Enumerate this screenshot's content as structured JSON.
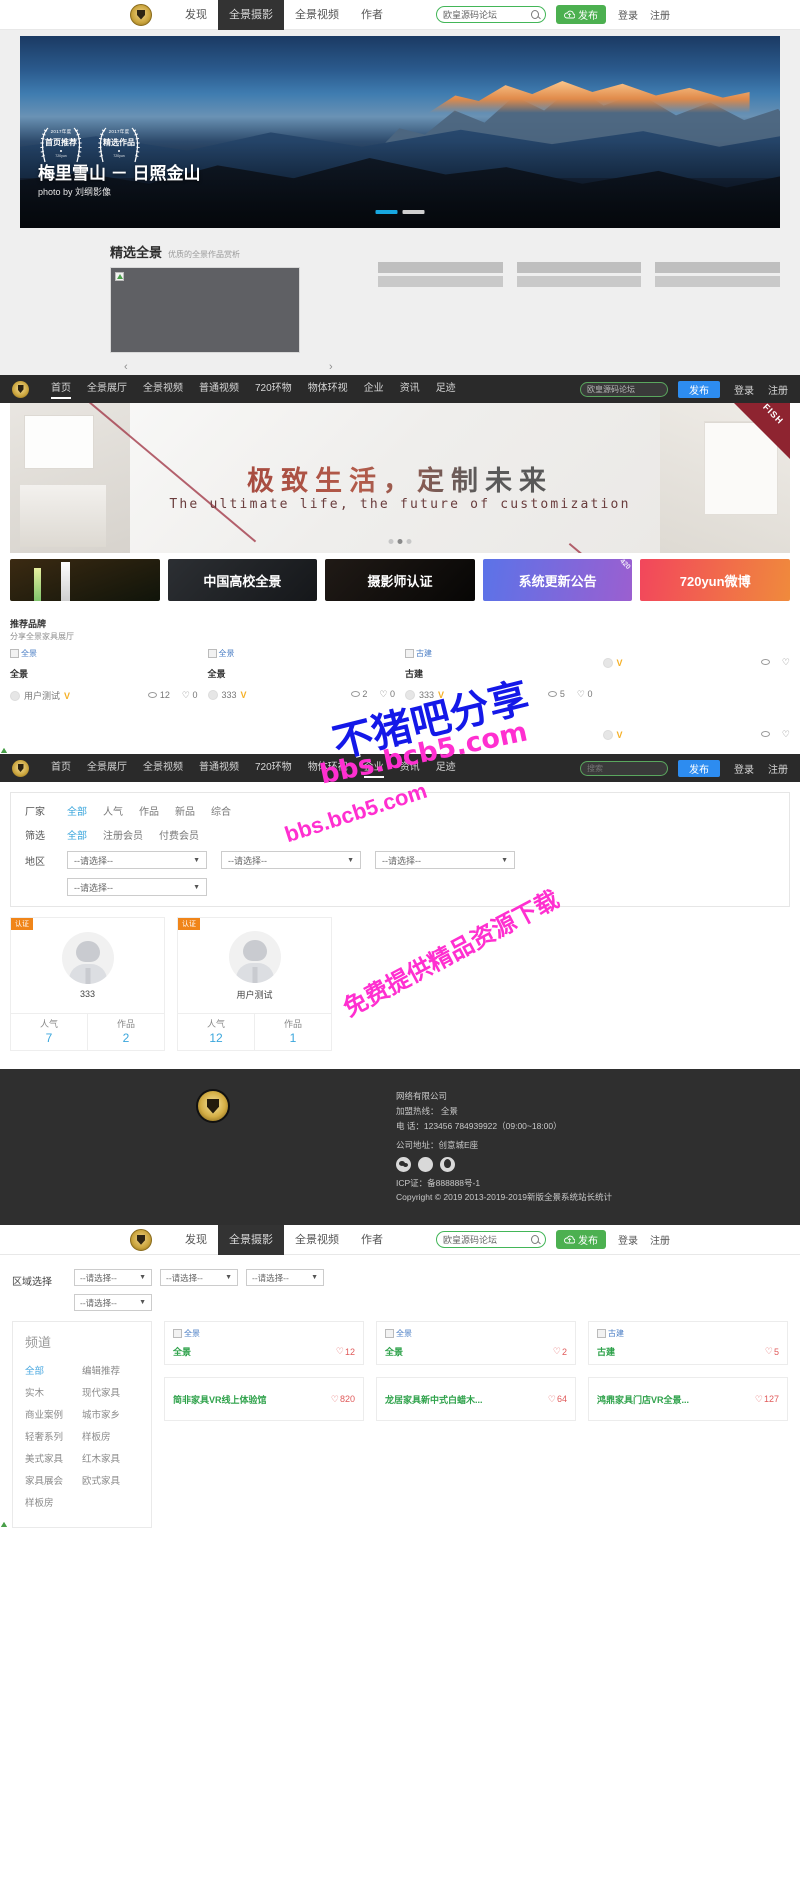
{
  "topnav": {
    "logo_icon": "shield-logo-icon",
    "items": [
      {
        "label": "发现",
        "active": false
      },
      {
        "label": "全景摄影",
        "active": true
      },
      {
        "label": "全景视频",
        "active": false
      },
      {
        "label": "作者",
        "active": false
      }
    ],
    "search": {
      "value": "欧皇源码论坛",
      "placeholder": "搜索",
      "icon": "search-icon"
    },
    "publish": {
      "label": "发布",
      "icon": "cloud-upload-icon"
    },
    "login": "登录",
    "register": "注册"
  },
  "hero": {
    "title": "梅里雪山 － 日照金山",
    "photo_by": "photo by 刘纲影像",
    "badges": [
      {
        "year": "2017年度",
        "title": "首页推荐",
        "sub": "720yun"
      },
      {
        "year": "2017年度",
        "title": "精选作品",
        "sub": "720yun"
      }
    ],
    "dots": [
      true,
      false
    ]
  },
  "featured": {
    "title": "精选全景",
    "desc": "优质的全景作品赏析",
    "prev_icon": "chevron-left-icon",
    "next_icon": "chevron-right-icon"
  },
  "darknav": {
    "items": [
      {
        "label": "首页",
        "active": true
      },
      {
        "label": "全景展厅",
        "active": false
      },
      {
        "label": "全景视频",
        "active": false
      },
      {
        "label": "普通视频",
        "active": false
      },
      {
        "label": "720环物",
        "active": false
      },
      {
        "label": "物体环视",
        "active": false
      },
      {
        "label": "企业",
        "active": false
      },
      {
        "label": "资讯",
        "active": false
      },
      {
        "label": "足迹",
        "active": false
      }
    ],
    "search": {
      "value": "欧皇源码论坛",
      "placeholder": "搜索"
    },
    "publish": "发布",
    "login": "登录",
    "register": "注册"
  },
  "furniture_banner": {
    "cn": "极致生活，定制未来",
    "en": "The ultimate life, the future of customization",
    "corner": "FISH",
    "dots": [
      false,
      true,
      false
    ]
  },
  "promos": [
    {
      "label": "",
      "style": "p1"
    },
    {
      "label": "中国高校全景",
      "style": "p2"
    },
    {
      "label": "摄影师认证",
      "style": "p3"
    },
    {
      "label": "系统更新公告",
      "style": "p4",
      "ribbon": "420"
    },
    {
      "label": "720yun微博",
      "style": "p5"
    }
  ],
  "brand": {
    "title": "推荐品牌",
    "desc": "分享全景家具展厅",
    "cards_row1": [
      {
        "img_alt": "全景",
        "name": "全景",
        "author": "用户测试",
        "verified": "V",
        "views": "12",
        "likes": "0"
      },
      {
        "img_alt": "全景",
        "name": "全景",
        "author": "333",
        "verified": "V",
        "views": "2",
        "likes": "0"
      },
      {
        "img_alt": "古建",
        "name": "古建",
        "author": "333",
        "verified": "V",
        "views": "5",
        "likes": "0"
      },
      {
        "img_alt": "",
        "name": "",
        "author": "",
        "verified": "V",
        "views": "",
        "likes": ""
      }
    ],
    "cards_row2": [
      {
        "author": "",
        "verified": "V",
        "views": "",
        "likes": ""
      }
    ]
  },
  "filters": {
    "rows": [
      {
        "label": "厂家",
        "options": [
          {
            "text": "全部",
            "on": true
          },
          {
            "text": "人气",
            "on": false
          },
          {
            "text": "作品",
            "on": false
          },
          {
            "text": "新品",
            "on": false
          },
          {
            "text": "综合",
            "on": false
          }
        ]
      },
      {
        "label": "筛选",
        "options": [
          {
            "text": "全部",
            "on": true
          },
          {
            "text": "注册会员",
            "on": false
          },
          {
            "text": "付费会员",
            "on": false
          }
        ]
      }
    ],
    "region_label": "地区",
    "selects": [
      "--请选择--",
      "--请选择--",
      "--请选择--"
    ],
    "select_second_row": "--请选择--"
  },
  "authors": [
    {
      "cert": "认证",
      "name": "333",
      "stats": [
        {
          "k": "人气",
          "v": "7"
        },
        {
          "k": "作品",
          "v": "2"
        }
      ]
    },
    {
      "cert": "认证",
      "name": "用户测试",
      "stats": [
        {
          "k": "人气",
          "v": "12"
        },
        {
          "k": "作品",
          "v": "1"
        }
      ]
    }
  ],
  "footer": {
    "company": "网络有限公司",
    "hotline": "加盟热线：     全景",
    "phone": "电 话：123456 784939922（09:00~18:00）",
    "address": "公司地址：创意城E座",
    "social": [
      "wechat-icon",
      "weibo-icon",
      "qq-icon"
    ],
    "icp": "ICP证：备888888号-1",
    "copyright": "Copyright © 2019 2013-2019-2019新版全景系统站长统计"
  },
  "lastsection": {
    "area_label": "区域选择",
    "selects_row1": [
      "--请选择--",
      "--请选择--",
      "--请选择--"
    ],
    "selects_row2": [
      "--请选择--"
    ],
    "channel": {
      "title": "频道",
      "items": [
        {
          "text": "全部",
          "on": true
        },
        {
          "text": "编辑推荐",
          "on": false
        },
        {
          "text": "实木",
          "on": false
        },
        {
          "text": "现代家具",
          "on": false
        },
        {
          "text": "商业案例",
          "on": false
        },
        {
          "text": "城市家乡",
          "on": false
        },
        {
          "text": "轻奢系列",
          "on": false
        },
        {
          "text": "样板房",
          "on": false
        },
        {
          "text": "美式家具",
          "on": false
        },
        {
          "text": "红木家具",
          "on": false
        },
        {
          "text": "家具展会",
          "on": false
        },
        {
          "text": "欧式家具",
          "on": false
        },
        {
          "text": "样板房",
          "on": false
        }
      ]
    },
    "works_row1": [
      {
        "img_alt": "全景",
        "name": "全景",
        "likes": "12"
      },
      {
        "img_alt": "全景",
        "name": "全景",
        "likes": "2"
      },
      {
        "img_alt": "古建",
        "name": "古建",
        "likes": "5"
      }
    ],
    "works_row2": [
      {
        "name": "简非家具VR线上体验馆",
        "likes": "820"
      },
      {
        "name": "龙居家具新中式白蜡木...",
        "likes": "64"
      },
      {
        "name": "鸿鼎家具门店VR全景...",
        "likes": "127"
      }
    ]
  },
  "watermarks": {
    "w1": "不猪吧分享",
    "w2": "bbs.bcb5.com",
    "w3": "免费提供精品资源下载"
  }
}
